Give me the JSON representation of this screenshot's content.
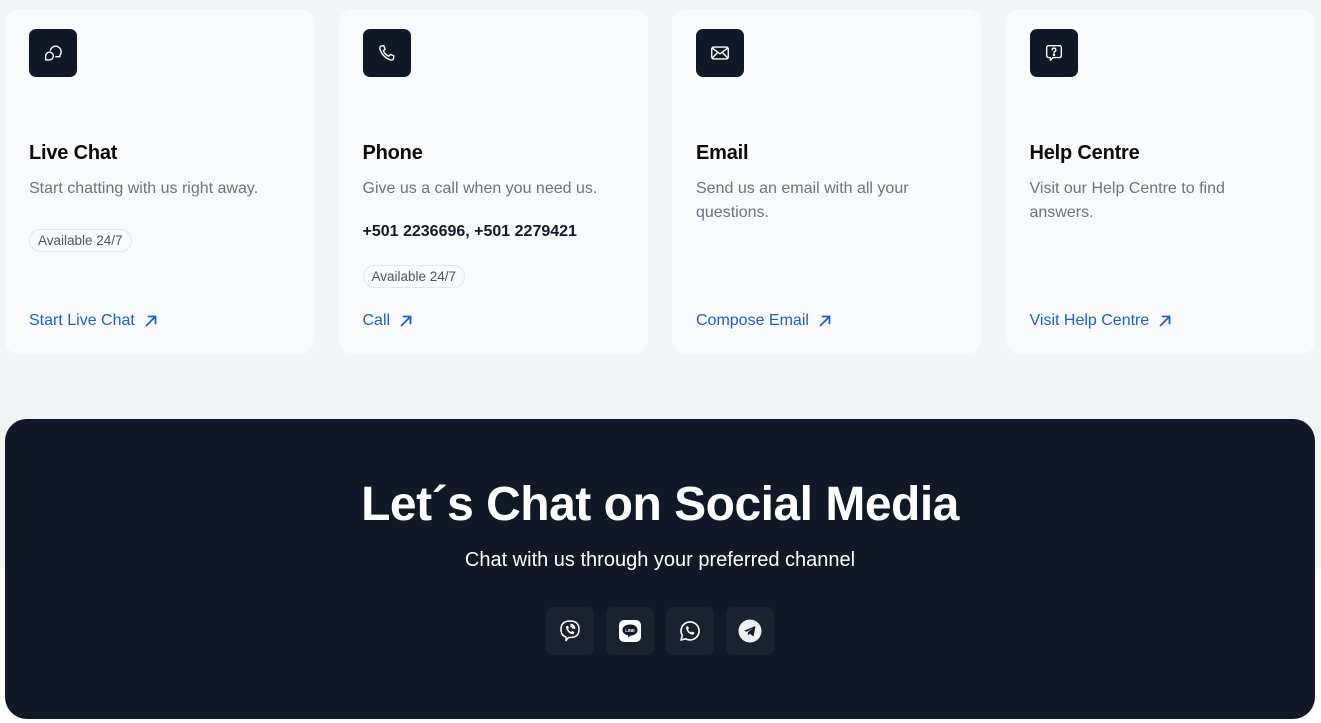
{
  "cards": [
    {
      "icon": "chat-bubbles-icon",
      "title": "Live Chat",
      "description": "Start chatting with us right away.",
      "badge": "Available 24/7",
      "link_label": "Start Live Chat"
    },
    {
      "icon": "phone-icon",
      "title": "Phone",
      "description": "Give us a call when you need us.",
      "phone_numbers": "+501 2236696, +501 2279421",
      "badge": "Available 24/7",
      "link_label": "Call"
    },
    {
      "icon": "mail-icon",
      "title": "Email",
      "description": "Send us an email with all your questions.",
      "link_label": "Compose Email"
    },
    {
      "icon": "help-bubble-icon",
      "title": "Help Centre",
      "description": "Visit our Help Centre to find answers.",
      "link_label": "Visit Help Centre"
    }
  ],
  "social": {
    "title": "Let´s Chat on Social Media",
    "subtitle": "Chat with us through your preferred channel",
    "channels": [
      {
        "name": "Viber",
        "icon": "viber-icon"
      },
      {
        "name": "LINE",
        "icon": "line-icon"
      },
      {
        "name": "WhatsApp",
        "icon": "whatsapp-icon"
      },
      {
        "name": "Telegram",
        "icon": "telegram-icon"
      }
    ]
  },
  "colors": {
    "link": "#1d5fc9",
    "dark": "#111827",
    "card_bg": "#f8fafc",
    "page_bg": "#f3f4f6"
  }
}
